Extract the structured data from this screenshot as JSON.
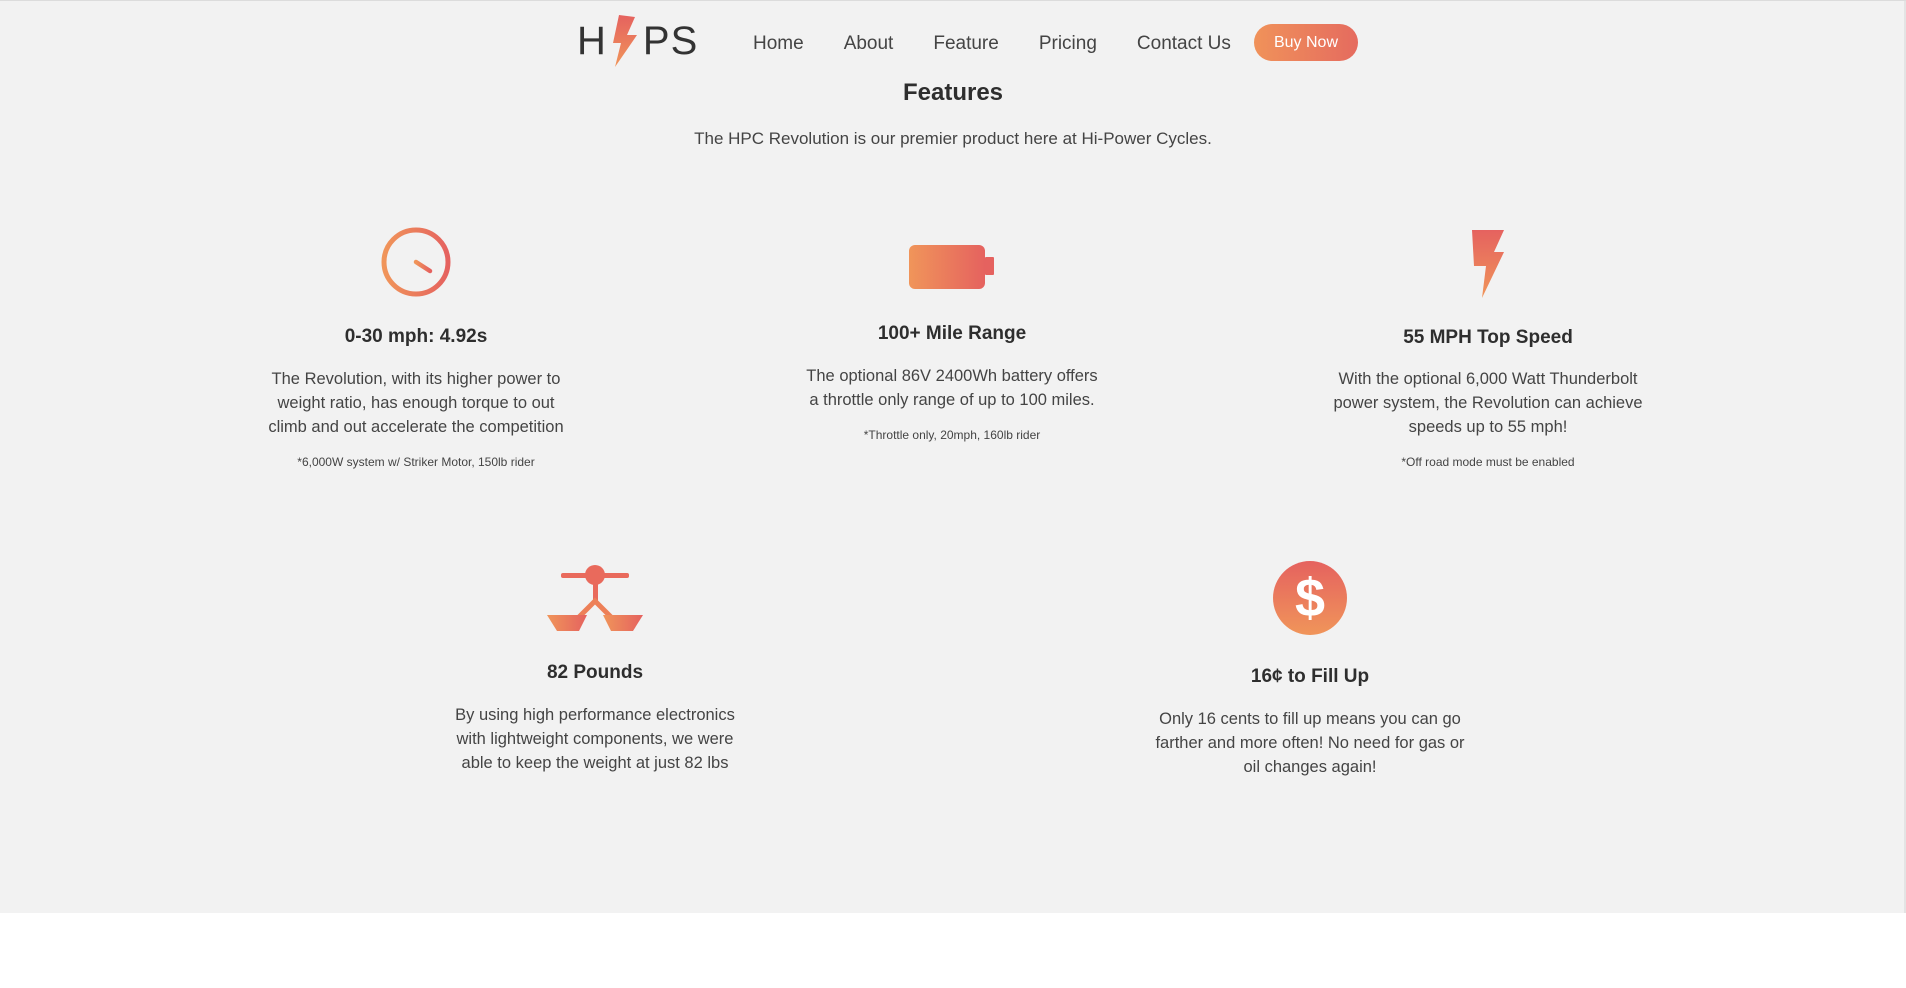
{
  "header": {
    "logo_left": "H",
    "logo_right": "PS",
    "nav": [
      "Home",
      "About",
      "Feature",
      "Pricing",
      "Contact Us"
    ],
    "buy_label": "Buy Now"
  },
  "section": {
    "title": "Features",
    "subtitle": "The HPC Revolution is our premier product here at Hi-Power Cycles."
  },
  "features": [
    {
      "icon": "clock-icon",
      "title": "0-30 mph: 4.92s",
      "desc": "The Revolution, with its higher power to weight ratio, has enough torque to out climb and out accelerate the competition",
      "note": "*6,000W system w/ Striker Motor, 150lb rider"
    },
    {
      "icon": "battery-icon",
      "title": "100+ Mile Range",
      "desc": "The optional 86V 2400Wh battery offers a throttle only range of up to 100 miles.",
      "note": "*Throttle only, 20mph, 160lb rider"
    },
    {
      "icon": "lightning-icon",
      "title": "55 MPH Top Speed",
      "desc": "With the optional 6,000 Watt Thunderbolt power system, the Revolution can achieve speeds up to 55 mph!",
      "note": "*Off road mode must be enabled"
    },
    {
      "icon": "scale-icon",
      "title": "82 Pounds",
      "desc": "By using high performance electronics with lightweight components, we were able to keep the weight at just 82 lbs"
    },
    {
      "icon": "dollar-icon",
      "title": "16¢ to Fill Up",
      "desc": "Only 16 cents to fill up means you can go farther and more often! No need for gas or oil changes again!"
    }
  ],
  "colors": {
    "accent_start": "#f0925a",
    "accent_end": "#e56b5f",
    "section_bg": "#f2f2f2",
    "text": "#333333"
  }
}
